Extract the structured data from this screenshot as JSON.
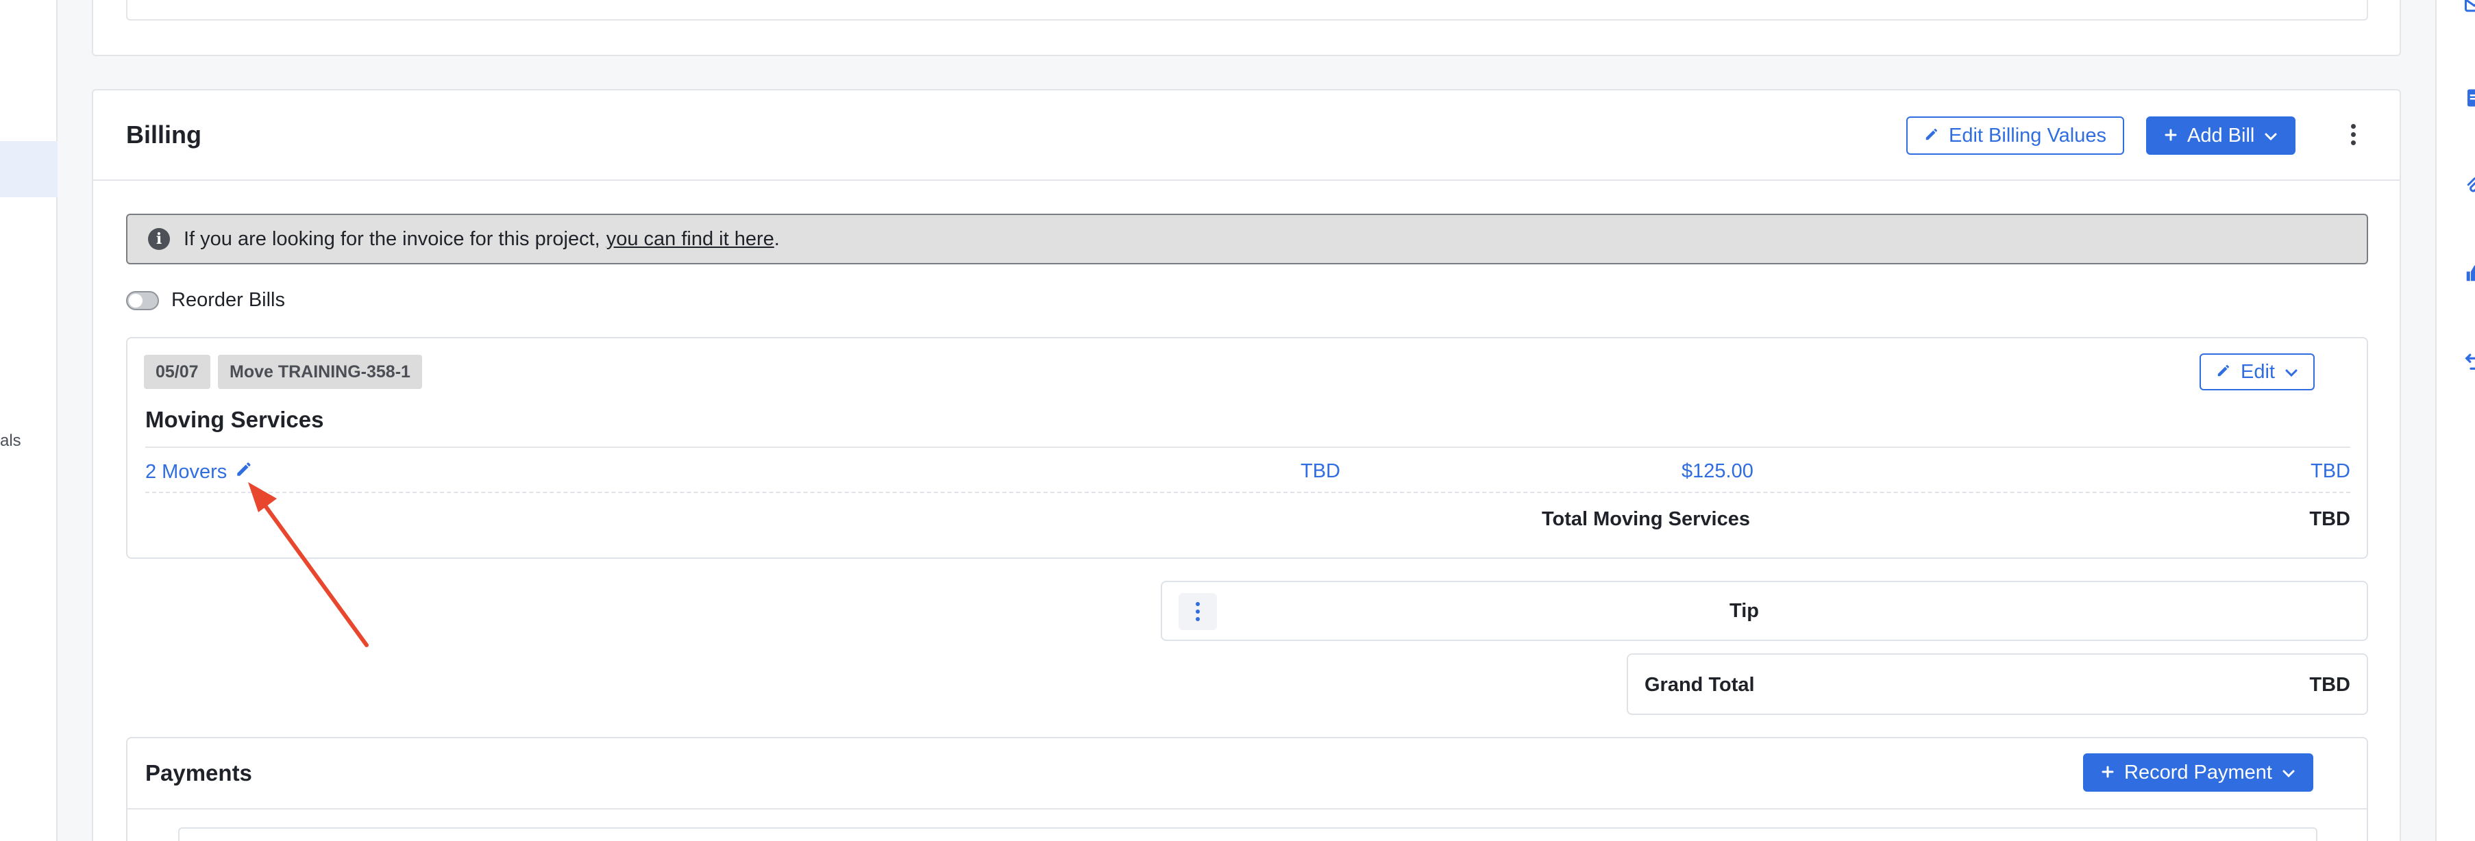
{
  "left_sidebar": {
    "cut_label": "als"
  },
  "billing": {
    "title": "Billing",
    "edit_billing_values_label": "Edit Billing Values",
    "add_bill_label": "Add Bill",
    "info_banner": {
      "text": "If you are looking for the invoice for this project,",
      "link_text": "you can find it here",
      "suffix": "."
    },
    "reorder_bills_label": "Reorder Bills",
    "bill": {
      "date_tag": "05/07",
      "move_tag": "Move TRAINING-358-1",
      "edit_label": "Edit",
      "title": "Moving Services",
      "line_items": [
        {
          "name": "2 Movers",
          "quantity": "TBD",
          "rate": "$125.00",
          "amount": "TBD"
        }
      ],
      "total_label": "Total Moving Services",
      "total_value": "TBD"
    },
    "tip": {
      "label": "Tip"
    },
    "grand_total": {
      "label": "Grand Total",
      "value": "TBD"
    },
    "payments": {
      "title": "Payments",
      "record_payment_label": "Record Payment"
    }
  },
  "colors": {
    "primary": "#2f6de0",
    "annotation_arrow": "#e8472e",
    "banner_bg": "#e0e0e0"
  },
  "icons": [
    "pencil-icon",
    "plus-icon",
    "chevron-down-icon",
    "kebab-icon",
    "info-icon",
    "mail-icon",
    "document-icon",
    "paperclip-icon",
    "thumbs-up-icon",
    "undo-icon"
  ]
}
